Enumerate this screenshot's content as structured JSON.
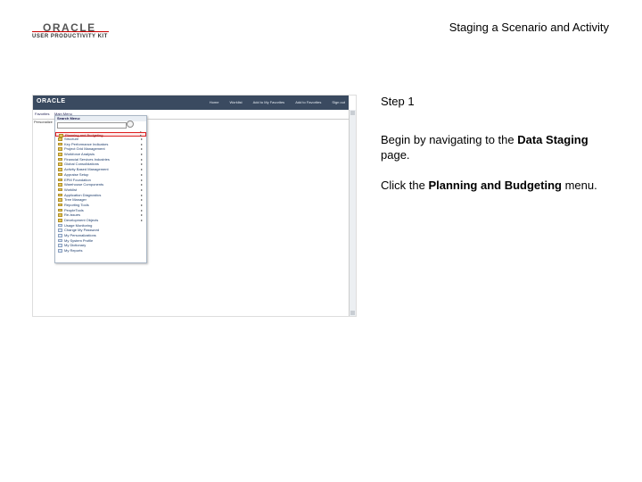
{
  "logo": {
    "brand": "ORACLE",
    "product": "USER PRODUCTIVITY KIT"
  },
  "title": "Staging a Scenario and Activity",
  "screenshot": {
    "app_logo": "ORACLE",
    "nav": [
      "Home",
      "Worklist",
      "Add to My Favorites",
      "Add to Favorites",
      "Sign out"
    ],
    "sub_links": [
      "Favorites",
      "Main Menu"
    ],
    "left_label": "Personalize",
    "menu_title": "Search Menu:",
    "menu_items": [
      {
        "label": "Planning and Budgeting",
        "type": "folder",
        "arrow": true,
        "selected": true
      },
      {
        "label": "Structure",
        "type": "folder",
        "arrow": true
      },
      {
        "label": "Key Performance Indicators",
        "type": "folder",
        "arrow": true
      },
      {
        "label": "Project Grid Management",
        "type": "folder",
        "arrow": true
      },
      {
        "label": "Workforce Analysis",
        "type": "folder",
        "arrow": true
      },
      {
        "label": "Financial Services Industries",
        "type": "folder",
        "arrow": true
      },
      {
        "label": "Global Consolidations",
        "type": "folder",
        "arrow": true
      },
      {
        "label": "Activity Based Management",
        "type": "folder",
        "arrow": true
      },
      {
        "label": "Appraise Setup",
        "type": "folder",
        "arrow": true
      },
      {
        "label": "EPM Foundation",
        "type": "folder",
        "arrow": true
      },
      {
        "label": "Warehouse Components",
        "type": "folder",
        "arrow": true
      },
      {
        "label": "Worklist",
        "type": "folder",
        "arrow": true
      },
      {
        "label": "Application Diagnostics",
        "type": "folder",
        "arrow": true
      },
      {
        "label": "Tree Manager",
        "type": "folder",
        "arrow": true
      },
      {
        "label": "Reporting Tools",
        "type": "folder",
        "arrow": true
      },
      {
        "label": "PeopleTools",
        "type": "folder",
        "arrow": true
      },
      {
        "label": "Re-Issues",
        "type": "folder",
        "arrow": true
      },
      {
        "label": "Development Objects",
        "type": "folder",
        "arrow": true
      },
      {
        "label": "Usage Monitoring",
        "type": "page",
        "arrow": false
      },
      {
        "label": "Change My Password",
        "type": "page",
        "arrow": false
      },
      {
        "label": "My Personalizations",
        "type": "page",
        "arrow": false
      },
      {
        "label": "My System Profile",
        "type": "page",
        "arrow": false
      },
      {
        "label": "My Dictionary",
        "type": "page",
        "arrow": false
      },
      {
        "label": "My Reports",
        "type": "page",
        "arrow": false
      }
    ]
  },
  "step": "Step 1",
  "instruction1": {
    "pre": "Begin by navigating to the ",
    "bold": "Data Staging",
    "post": " page."
  },
  "instruction2": {
    "pre": "Click the ",
    "bold": "Planning and Budgeting",
    "post": " menu."
  }
}
